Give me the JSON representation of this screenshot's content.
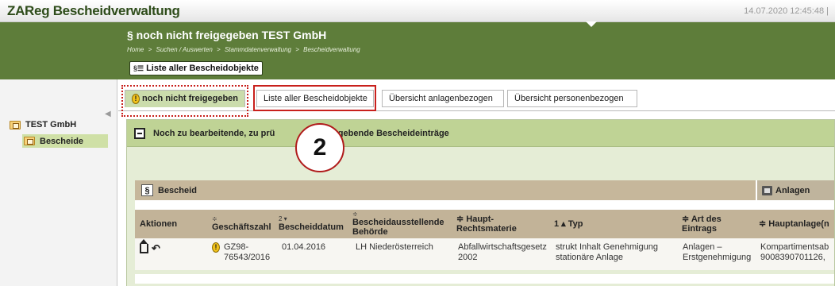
{
  "app": {
    "title": "ZAReg Bescheidverwaltung",
    "timestamp": "14.07.2020 12:45:48 |"
  },
  "header": {
    "page_title": "§  noch nicht freigegeben TEST GmbH",
    "breadcrumb": [
      "Home",
      ">",
      "Suchen / Auswerten",
      ">",
      "Stammdatenverwaltung",
      ">",
      "Bescheidverwaltung"
    ],
    "list_button_icon": "§☰",
    "list_button_label": "Liste aller Bescheidobjekte"
  },
  "sidebar": {
    "root_label": "TEST GmbH",
    "child_label": "Bescheide",
    "collapse_icon": "◀"
  },
  "tabs": [
    {
      "label": "noch nicht freigegeben",
      "active": true
    },
    {
      "label": "Liste aller Bescheidobjekte",
      "active": false
    },
    {
      "label": "Übersicht anlagenbezogen",
      "active": false
    },
    {
      "label": "Übersicht personenbezogen",
      "active": false
    }
  ],
  "section": {
    "title": "Noch zu bearbeitende, zu prü",
    "title_tail": "eizugebende Bescheideinträge",
    "callout_number": "2"
  },
  "table": {
    "group_bescheid": "Bescheid",
    "group_anlagen": "Anlagen",
    "columns": [
      {
        "sort": "",
        "label": "Aktionen"
      },
      {
        "sort": "≑",
        "label": "Geschäftszahl"
      },
      {
        "sort": "2 ▾",
        "label": "Bescheiddatum"
      },
      {
        "sort": "≑",
        "label": "Bescheidausstellende Behörde"
      },
      {
        "sort": "",
        "label": "≑ Haupt-Rechtsmaterie"
      },
      {
        "sort": "",
        "label": "1 ▴ Typ"
      },
      {
        "sort": "",
        "label": "≑ Art des Eintrags"
      },
      {
        "sort": "",
        "label": "≑ Hauptanlage(n"
      }
    ],
    "rows": [
      {
        "geschaeftszahl": "GZ98-76543/2016",
        "bescheiddatum": "01.04.2016",
        "behoerde": "LH Niederösterreich",
        "rechtsmaterie": "Abfallwirtschaftsgesetz 2002",
        "typ": "strukt Inhalt Genehmigung stationäre Anlage",
        "art": "Anlagen – Erstgenehmigung",
        "hauptanlage": "Kompartimentsab 9008390701126,"
      }
    ]
  },
  "colors": {
    "header_green": "#5e7d3a",
    "active_tab": "#cbdcac",
    "highlight_red": "#c8201c",
    "table_header": "#c2b398"
  },
  "icons": {
    "warning": "!",
    "paragraph": "§",
    "back": "↶"
  }
}
